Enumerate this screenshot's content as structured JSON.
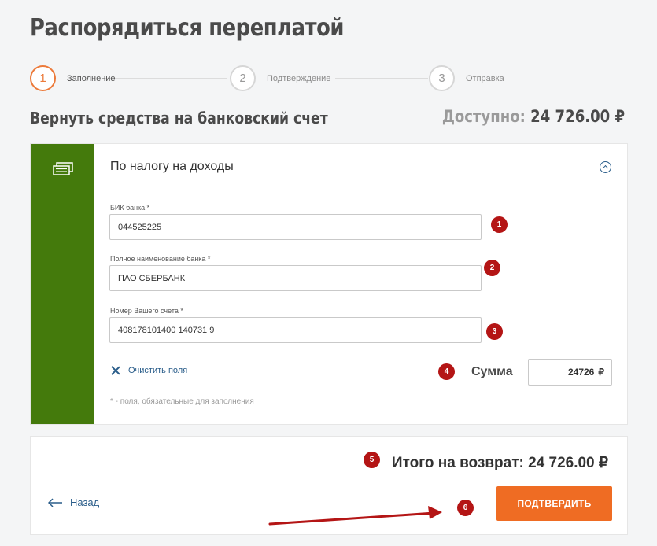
{
  "page_title": "Распорядиться переплатой",
  "steps": [
    {
      "num": "1",
      "label": "Заполнение"
    },
    {
      "num": "2",
      "label": "Подтверждение"
    },
    {
      "num": "3",
      "label": "Отправка"
    }
  ],
  "subtitle": "Вернуть средства на банковский счет",
  "available": {
    "label": "Доступно:",
    "value": "24 726.00 ₽"
  },
  "card": {
    "title": "По налогу на доходы",
    "fields": [
      {
        "label": "БИК банка *",
        "value": "044525225"
      },
      {
        "label": "Полное наименование банка *",
        "value": "ПАО СБЕРБАНК"
      },
      {
        "label": "Номер Вашего счета *",
        "value": "408178101400 140731 9"
      }
    ],
    "clear_label": "Очистить поля",
    "sum_label": "Сумма",
    "sum_value": "24726",
    "sum_currency": "₽",
    "required_note": "* - поля, обязательные для заполнения"
  },
  "footer": {
    "total": "Итого на возврат: 24 726.00 ₽",
    "back_label": "Назад",
    "confirm_label": "ПОДТВЕРДИТЬ"
  },
  "annotations": [
    "1",
    "2",
    "3",
    "4",
    "5",
    "6"
  ],
  "colors": {
    "accent": "#ef6c23",
    "side": "#447a0c",
    "badge": "#b41515",
    "link": "#2a5d8a"
  }
}
